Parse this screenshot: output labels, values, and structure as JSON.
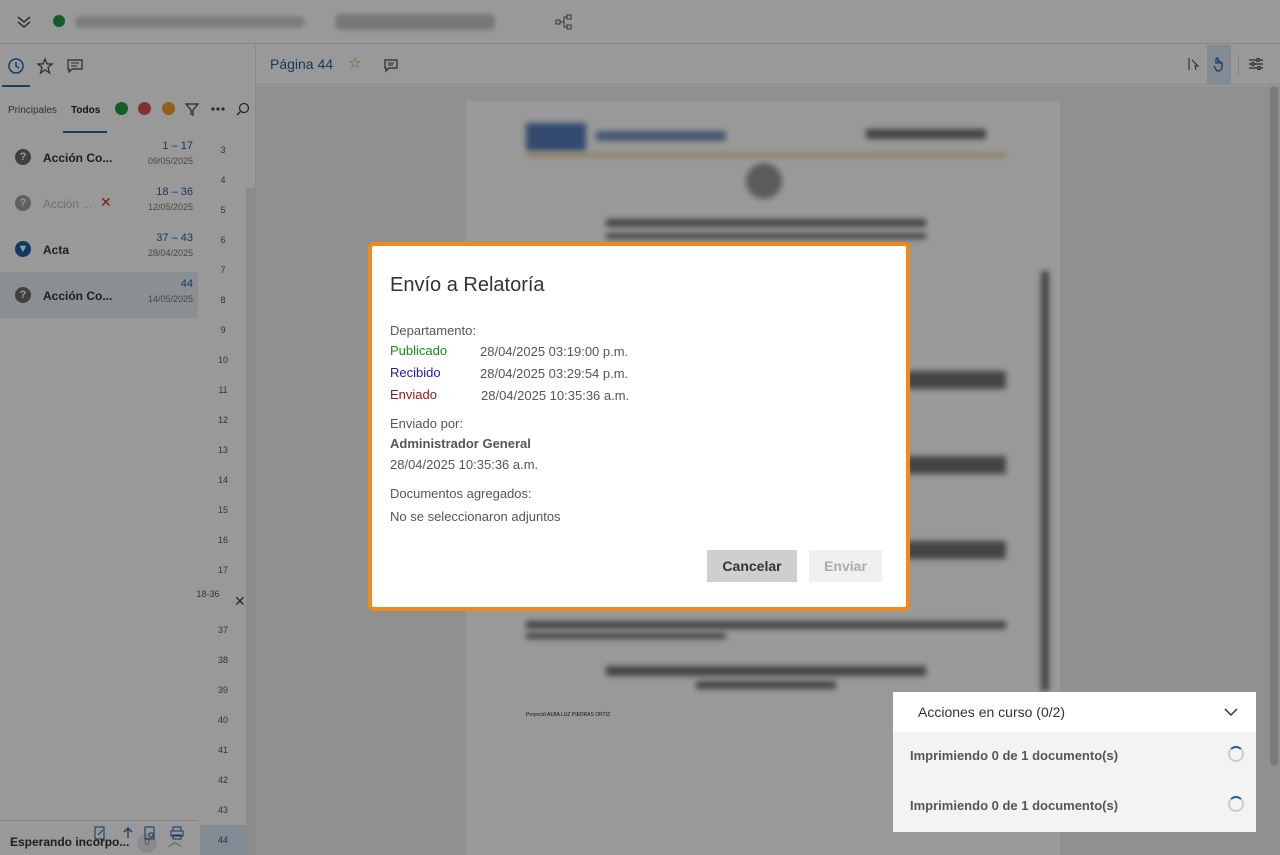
{
  "toolbar": {
    "page_title": "Página 44"
  },
  "left_panel": {
    "tabs": [
      "Principales",
      "Todos"
    ],
    "documents": [
      {
        "title": "Acción Co...",
        "range": "1 – 17",
        "date": "09/05/2025",
        "icon": "question-icon",
        "faded": false
      },
      {
        "title": "Acción ...",
        "range": "18 – 36",
        "date": "12/05/2025",
        "icon": "question-icon",
        "faded": true
      },
      {
        "title": "Acta",
        "range": "37 – 43",
        "date": "28/04/2025",
        "icon": "person-icon",
        "faded": false
      },
      {
        "title": "Acción Co...",
        "range": "44",
        "date": "14/05/2025",
        "icon": "question-icon",
        "faded": false
      }
    ],
    "page_numbers": [
      "3",
      "4",
      "5",
      "6",
      "7",
      "8",
      "9",
      "10",
      "11",
      "12",
      "13",
      "14",
      "15",
      "16",
      "17",
      "18-36",
      "37",
      "38",
      "39",
      "40",
      "41",
      "42",
      "43",
      "44"
    ],
    "waiting_label": "Esperando incorpo...",
    "waiting_count": "0"
  },
  "document": {
    "footer_text": "Proyectó:ALBA LUZ PIEDRAS ORTÍZ"
  },
  "actions_panel": {
    "title": "Acciones en curso (0/2)",
    "items": [
      "Imprimiendo 0 de 1 documento(s)",
      "Imprimiendo 0 de 1 documento(s)"
    ]
  },
  "dialog": {
    "title": "Envío a Relatoría",
    "department_label": "Departamento:",
    "statuses": [
      {
        "label": "Publicado",
        "value": "28/04/2025 03:19:00 p.m.",
        "color": "#1a8a1a"
      },
      {
        "label": "Recibido",
        "value": "28/04/2025 03:29:54 p.m.",
        "color": "#2020b0"
      },
      {
        "label": "Enviado",
        "value": "28/04/2025 10:35:36 a.m.",
        "color": "#8b1a1a"
      }
    ],
    "sent_by_label": "Enviado por:",
    "sent_by_name": "Administrador General",
    "sent_by_date": "28/04/2025 10:35:36 a.m.",
    "attachments_label": "Documentos agregados:",
    "attachments_value": "No se seleccionaron adjuntos",
    "cancel_label": "Cancelar",
    "send_label": "Enviar"
  },
  "colors": {
    "accent": "#1f5f9f",
    "dialog_border": "#f08a1c"
  }
}
